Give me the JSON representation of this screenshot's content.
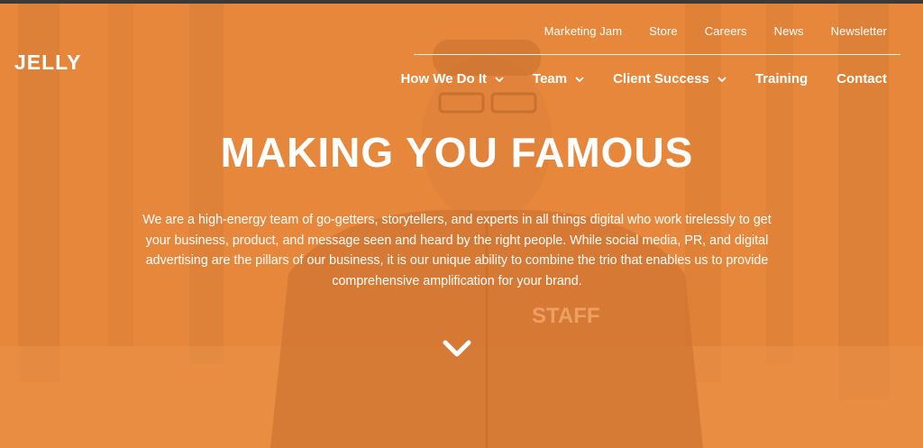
{
  "brand": {
    "logo_text": "JELLY"
  },
  "top_nav": [
    {
      "label": "Marketing Jam"
    },
    {
      "label": "Store"
    },
    {
      "label": "Careers"
    },
    {
      "label": "News"
    },
    {
      "label": "Newsletter"
    }
  ],
  "main_nav": [
    {
      "label": "How We Do It",
      "has_dropdown": true
    },
    {
      "label": "Team",
      "has_dropdown": true
    },
    {
      "label": "Client Success",
      "has_dropdown": true
    },
    {
      "label": "Training",
      "has_dropdown": false
    },
    {
      "label": "Contact",
      "has_dropdown": false
    }
  ],
  "hero": {
    "title": "MAKING YOU FAMOUS",
    "description": "We are a high-energy team of go-getters, storytellers, and experts in all things digital who work tirelessly to get your business, product, and message seen and heard by the right people. While social media, PR, and digital advertising are the pillars of our business, it is our unique ability to combine the trio that enables us to provide comprehensive amplification for your brand.",
    "scroll_icon": "chevron-down-icon"
  },
  "background": {
    "shirt_text": "STAFF"
  },
  "colors": {
    "overlay": "#e8873a",
    "text": "#ffffff"
  }
}
